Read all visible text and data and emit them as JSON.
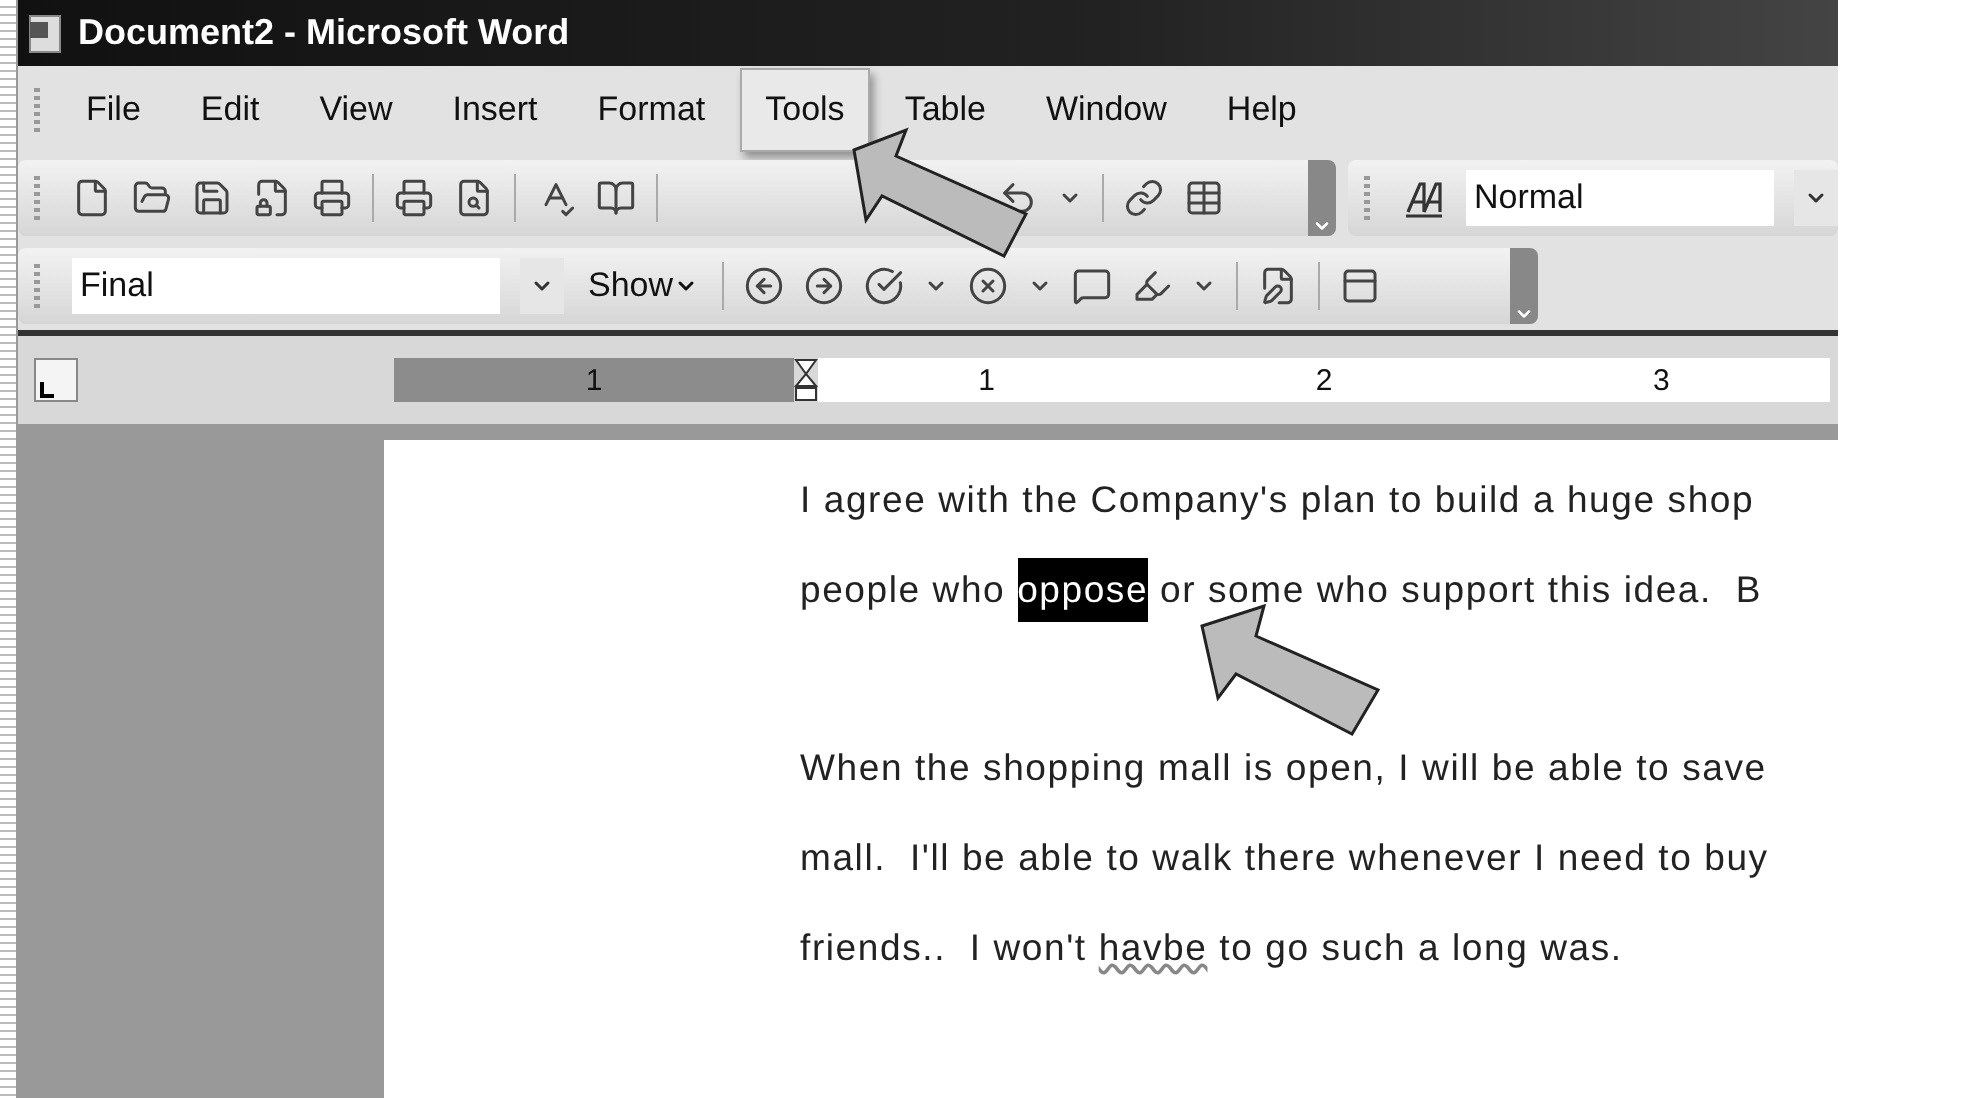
{
  "window": {
    "title": "Document2 - Microsoft Word"
  },
  "menu": [
    {
      "label": "File",
      "selected": false
    },
    {
      "label": "Edit",
      "selected": false
    },
    {
      "label": "View",
      "selected": false
    },
    {
      "label": "Insert",
      "selected": false
    },
    {
      "label": "Format",
      "selected": false
    },
    {
      "label": "Tools",
      "selected": true
    },
    {
      "label": "Table",
      "selected": false
    },
    {
      "label": "Window",
      "selected": false
    },
    {
      "label": "Help",
      "selected": false
    }
  ],
  "style_box": {
    "value": "Normal"
  },
  "reviewing_toolbar": {
    "display_box": {
      "value": "Final"
    },
    "show_button": {
      "label": "Show"
    }
  },
  "ruler": {
    "left_numbers": [
      "1"
    ],
    "right_numbers": [
      "1",
      "2",
      "3"
    ]
  },
  "document": {
    "paragraphs": [
      {
        "lines": [
          [
            {
              "text": "I agree with the Company's plan to build a huge shop",
              "selected": false,
              "misspelled": false
            }
          ],
          [
            {
              "text": "people who ",
              "selected": false,
              "misspelled": false
            },
            {
              "text": "oppose",
              "selected": true,
              "misspelled": false
            },
            {
              "text": " or some who support this idea.  B",
              "selected": false,
              "misspelled": false
            }
          ]
        ]
      },
      {
        "lines": [
          [
            {
              "text": "When the shopping mall is open, I will be able to save",
              "selected": false,
              "misspelled": false
            }
          ],
          [
            {
              "text": "mall.  I'll be able to walk there whenever I need to buy",
              "selected": false,
              "misspelled": false
            }
          ],
          [
            {
              "text": "friends..  I won't ",
              "selected": false,
              "misspelled": false
            },
            {
              "text": "havbe",
              "selected": false,
              "misspelled": true
            },
            {
              "text": " to go such a long was.",
              "selected": false,
              "misspelled": false
            }
          ]
        ]
      }
    ]
  }
}
